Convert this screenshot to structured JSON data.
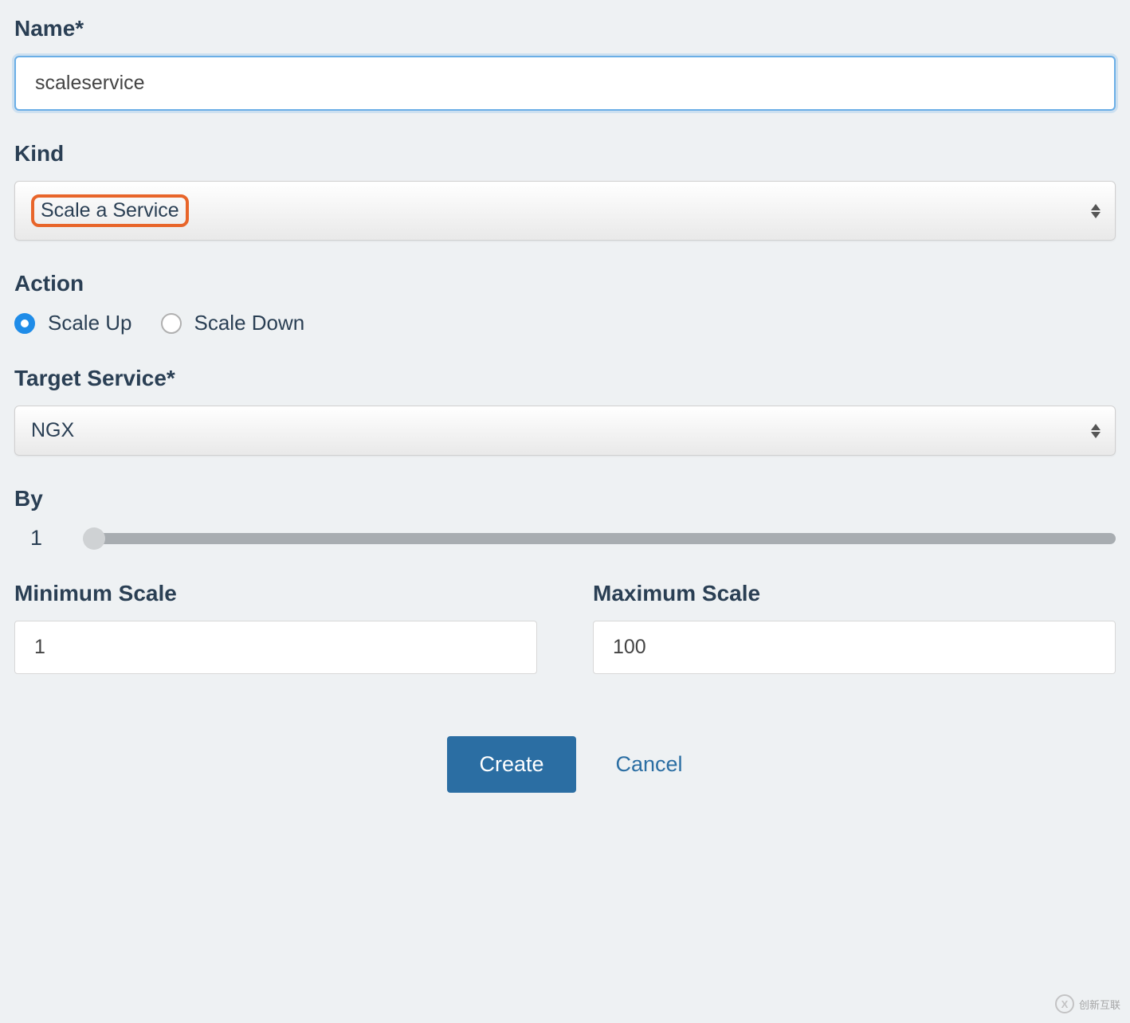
{
  "labels": {
    "name": "Name*",
    "kind": "Kind",
    "action": "Action",
    "target_service": "Target Service*",
    "by": "By",
    "min_scale": "Minimum Scale",
    "max_scale": "Maximum Scale"
  },
  "values": {
    "name": "scaleservice",
    "kind": "Scale a Service",
    "target_service": "NGX",
    "by": "1",
    "min_scale": "1",
    "max_scale": "100"
  },
  "action_options": {
    "scale_up": "Scale Up",
    "scale_down": "Scale Down"
  },
  "buttons": {
    "create": "Create",
    "cancel": "Cancel"
  },
  "watermark": {
    "text": "创新互联",
    "logo": "X"
  }
}
